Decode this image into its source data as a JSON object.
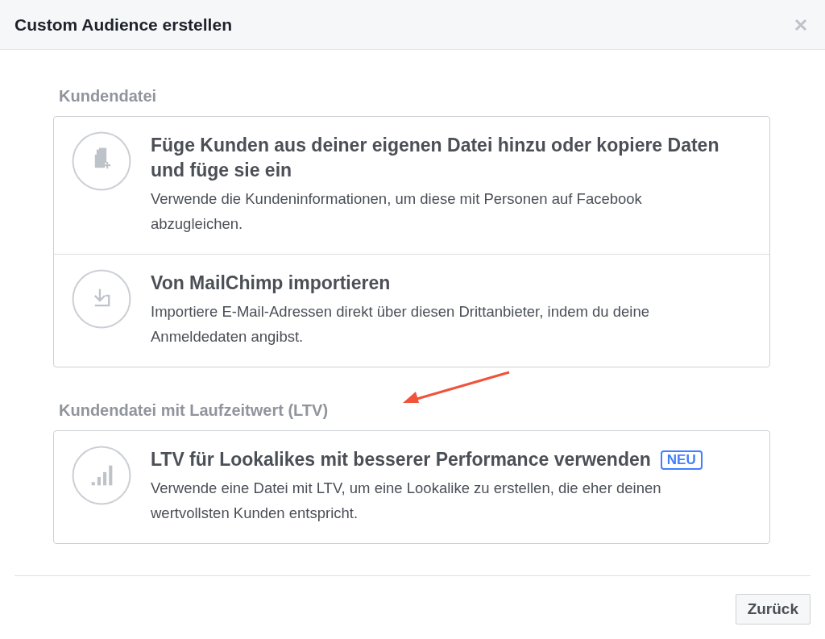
{
  "dialog": {
    "title": "Custom Audience erstellen"
  },
  "sections": [
    {
      "heading": "Kundendatei",
      "options": [
        {
          "kind": "file",
          "title": "Füge Kunden aus deiner eigenen Datei hinzu oder kopiere Daten und füge sie ein",
          "description": "Verwende die Kundeninformationen, um diese mit Personen auf Facebook abzugleichen."
        },
        {
          "kind": "import",
          "title": "Von MailChimp importieren",
          "description": "Importiere E-Mail-Adressen direkt über diesen Drittanbieter, indem du deine Anmeldedaten angibst."
        }
      ]
    },
    {
      "heading": "Kundendatei mit Laufzeitwert (LTV)",
      "options": [
        {
          "kind": "chart",
          "title": "LTV für Lookalikes mit besserer Performance verwenden",
          "badge": "NEU",
          "description": "Verwende eine Datei mit LTV, um eine Lookalike zu erstellen, die eher deinen wertvollsten Kunden entspricht."
        }
      ]
    }
  ],
  "footer": {
    "buttons": [
      "Zurück"
    ]
  }
}
